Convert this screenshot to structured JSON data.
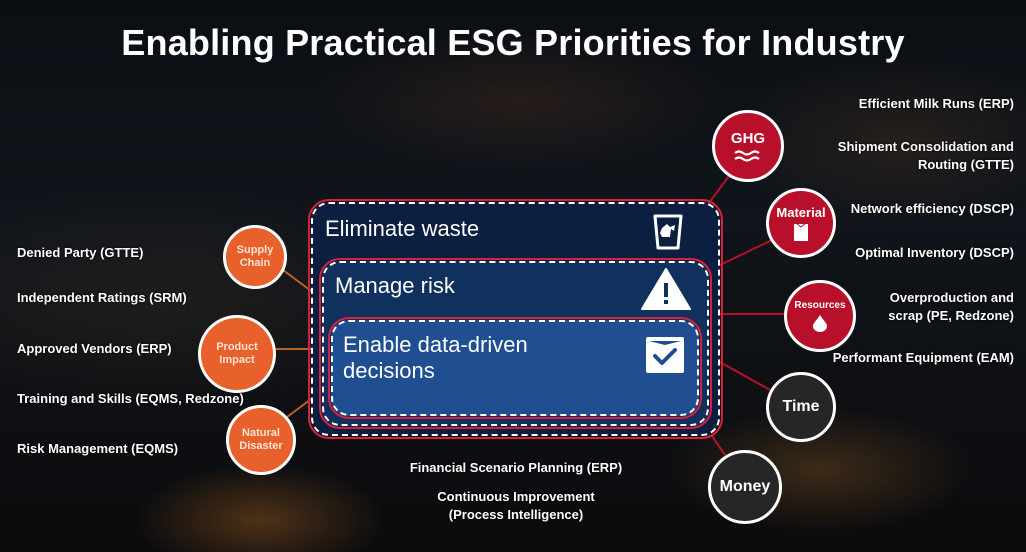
{
  "title": "Enabling Practical ESG Priorities for Industry",
  "nested_boxes": [
    {
      "label": "Eliminate waste",
      "icon": "recycle-bin-icon"
    },
    {
      "label": "Manage risk",
      "icon": "warning-icon"
    },
    {
      "label": "Enable data-driven decisions",
      "label_line1": "Enable data-driven",
      "label_line2": "decisions",
      "icon": "checkbox-icon"
    }
  ],
  "left_circles": [
    {
      "line1": "Supply",
      "line2": "Chain"
    },
    {
      "line1": "Product",
      "line2": "Impact"
    },
    {
      "line1": "Natural",
      "line2": "Disaster"
    }
  ],
  "left_items": [
    "Denied Party (GTTE)",
    "Independent Ratings (SRM)",
    "Approved Vendors (ERP)",
    "Training and Skills (EQMS, Redzone)",
    "Risk Management (EQMS)"
  ],
  "right_circles": [
    {
      "label": "GHG",
      "icon": "waves-icon"
    },
    {
      "label": "Material",
      "icon": "bag-icon"
    },
    {
      "label": "Resources",
      "icon": "droplet-icon"
    }
  ],
  "dark_circles": [
    "Time",
    "Money"
  ],
  "right_items": [
    {
      "line1": "Efficient Milk Runs (ERP)"
    },
    {
      "line1": "Shipment Consolidation and",
      "line2": "Routing (GTTE)"
    },
    {
      "line1": "Network efficiency (DSCP)"
    },
    {
      "line1": "Optimal Inventory (DSCP)"
    },
    {
      "line1": "Overproduction and",
      "line2": "scrap (PE, Redzone)"
    },
    {
      "line1": "Performant Equipment (EAM)"
    }
  ],
  "bottom_items": [
    {
      "line1": "Financial Scenario Planning (ERP)"
    },
    {
      "line1": "Continuous Improvement",
      "line2": "(Process Intelligence)"
    }
  ],
  "colors": {
    "orange": "#e8602c",
    "red": "#b8102a",
    "dark": "#262626",
    "navy_outer": "#0c1f40",
    "navy_mid": "#10305e",
    "navy_inner": "#1f4e91"
  }
}
